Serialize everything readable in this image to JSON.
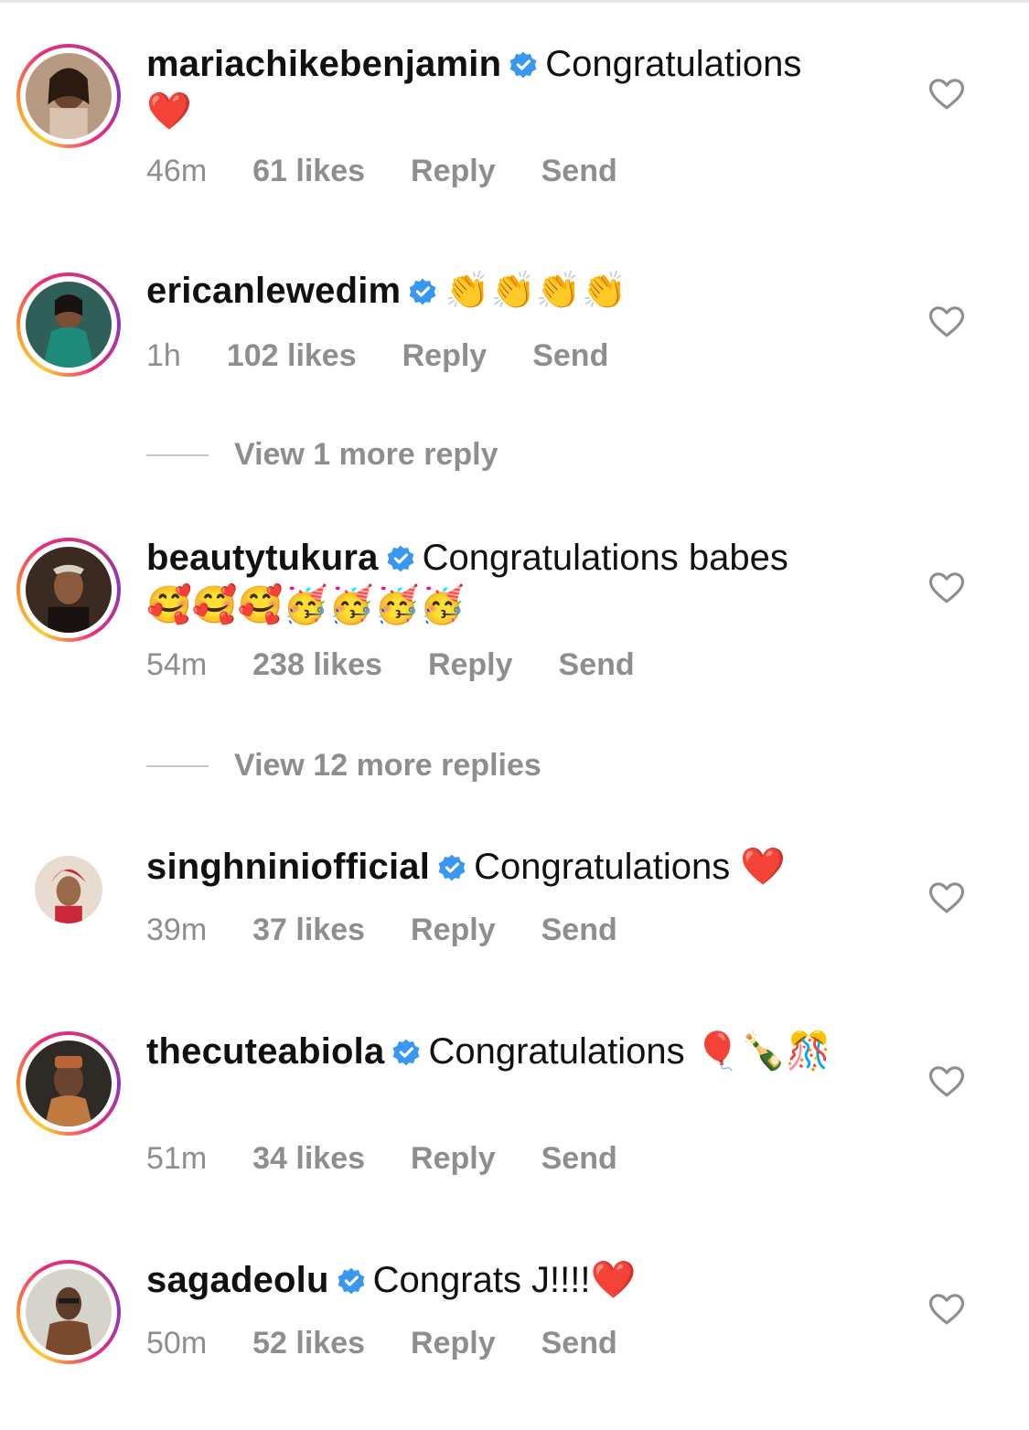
{
  "colors": {
    "verified": "#3897f0",
    "meta_text": "#8e8e8e",
    "ring_gradient": [
      "#f9ce34",
      "#ee2a7b",
      "#8a3ab9"
    ]
  },
  "comments": [
    {
      "username": "mariachikebenjamin",
      "verified": true,
      "text": "Congratulations",
      "emoji": "❤️",
      "time": "46m",
      "likes": "61 likes",
      "reply": "Reply",
      "send": "Send",
      "story_ring": true
    },
    {
      "username": "ericanlewedim",
      "verified": true,
      "text": "",
      "emoji": "👏👏👏👏",
      "time": "1h",
      "likes": "102 likes",
      "reply": "Reply",
      "send": "Send",
      "story_ring": true,
      "view_replies": "View 1 more reply"
    },
    {
      "username": "beautytukura",
      "verified": true,
      "text": "Congratulations babes",
      "emoji": "🥰🥰🥰🥳🥳🥳🥳",
      "time": "54m",
      "likes": "238 likes",
      "reply": "Reply",
      "send": "Send",
      "story_ring": true,
      "view_replies": "View 12 more replies"
    },
    {
      "username": "singhniniofficial",
      "verified": true,
      "text": "Congratulations",
      "emoji": "❤️",
      "time": "39m",
      "likes": "37 likes",
      "reply": "Reply",
      "send": "Send",
      "story_ring": false
    },
    {
      "username": "thecuteabiola",
      "verified": true,
      "text": "Congratulations",
      "emoji": "🎈🍾🎊",
      "time": "51m",
      "likes": "34 likes",
      "reply": "Reply",
      "send": "Send",
      "story_ring": true
    },
    {
      "username": "sagadeolu",
      "verified": true,
      "text": "Congrats J!!!!",
      "emoji": "❤️",
      "time": "50m",
      "likes": "52 likes",
      "reply": "Reply",
      "send": "Send",
      "story_ring": true
    }
  ]
}
